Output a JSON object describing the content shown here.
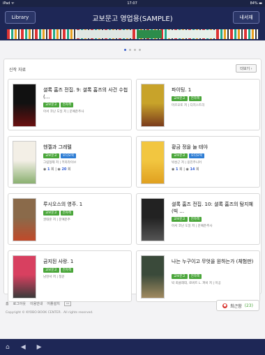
{
  "status": {
    "device": "iPad ᯤ",
    "time": "17:07",
    "battery": "84% ▬"
  },
  "nav": {
    "library_label": "Library",
    "title": "교보문고 영업용(SAMPLE)",
    "my_label": "내서재"
  },
  "pager": {
    "pages": 4,
    "active": 0
  },
  "section": {
    "title": "신작 자료",
    "more_label": "더보기 ›"
  },
  "books": [
    {
      "title": "셜록 홈즈 전집. 9: 셜록 홈즈의 사건 수첩 (...",
      "tags": [
        {
          "label": "교보문고",
          "color": "green"
        },
        {
          "label": "전자책",
          "color": "green"
        }
      ],
      "meta": "아서 코난 도일 저 | 문예춘추사",
      "cover_top": "#111111",
      "cover_bottom": "#6a1010"
    },
    {
      "title": "파이팅. 1",
      "tags": [
        {
          "label": "교보문고",
          "color": "green"
        },
        {
          "label": "전자책",
          "color": "green"
        }
      ],
      "meta": "마츠모토 저 | 디지스트리",
      "cover_top": "#c8a32a",
      "cover_bottom": "#7a3b1c"
    },
    {
      "title": "헨젤과 그레텔",
      "tags": [
        {
          "label": "교보문고",
          "color": "green"
        },
        {
          "label": "오디오북",
          "color": "blue"
        }
      ],
      "meta": "그림형제 저 | 키북라이브",
      "counts": {
        "a": "1",
        "b": "20"
      },
      "cover_top": "#f3efe6",
      "cover_bottom": "#8ab070"
    },
    {
      "title": "황금 정을 늘 테야",
      "tags": [
        {
          "label": "교보문고",
          "color": "green"
        },
        {
          "label": "오디오북",
          "color": "blue"
        }
      ],
      "meta": "박성근 저 | 웅진주니어",
      "counts": {
        "a": "1",
        "b": "14"
      },
      "cover_top": "#f2c640",
      "cover_bottom": "#e0a020"
    },
    {
      "title": "루시오스의 영주. 1",
      "tags": [
        {
          "label": "교보문고",
          "color": "green"
        },
        {
          "label": "전자책",
          "color": "green"
        }
      ],
      "meta": "권태훈 저 | 문예춘추",
      "cover_top": "#8a6a4a",
      "cover_bottom": "#c04a2a"
    },
    {
      "title": "셜록 홈즈 전집. 10: 셜록 홈즈의 탐지혜 (빅 ...",
      "tags": [
        {
          "label": "교보문고",
          "color": "green"
        },
        {
          "label": "전자책",
          "color": "green"
        }
      ],
      "meta": "아서 코난 도일 저 | 문예춘추사",
      "cover_top": "#222222",
      "cover_bottom": "#555555"
    },
    {
      "title": "금지된 사랑. 1",
      "tags": [
        {
          "label": "교보문고",
          "color": "green"
        },
        {
          "label": "전자책",
          "color": "green"
        }
      ],
      "meta": "남현서 저 | 청운",
      "cover_top": "#d84060",
      "cover_bottom": "#3a3a3a"
    },
    {
      "title": "나는 누구이고 무엇을 원하는가 (체험판)",
      "tags": [
        {
          "label": "교보문고",
          "color": "green"
        },
        {
          "label": "전자책",
          "color": "green"
        }
      ],
      "meta": "박 회클레데, 로버트 L. 퍼비 저 | 미공",
      "cover_top": "#3a4a3a",
      "cover_bottom": "#a08a60"
    }
  ],
  "footer": {
    "links": [
      "홈",
      "로그아웃",
      "이용안내",
      "어플설치"
    ],
    "box_label": "▭",
    "copyright": "Copyright © KYOBO BOOK CENTER . All rights reserved.",
    "recent_label": "최근함",
    "recent_count": "(23)"
  },
  "bottombar": {
    "home": "⌂",
    "back": "◀",
    "forward": "▶"
  },
  "colors": {
    "navy": "#1e2756",
    "green": "#4aa63a",
    "blue": "#2e7dd4",
    "red": "#d8322c"
  }
}
